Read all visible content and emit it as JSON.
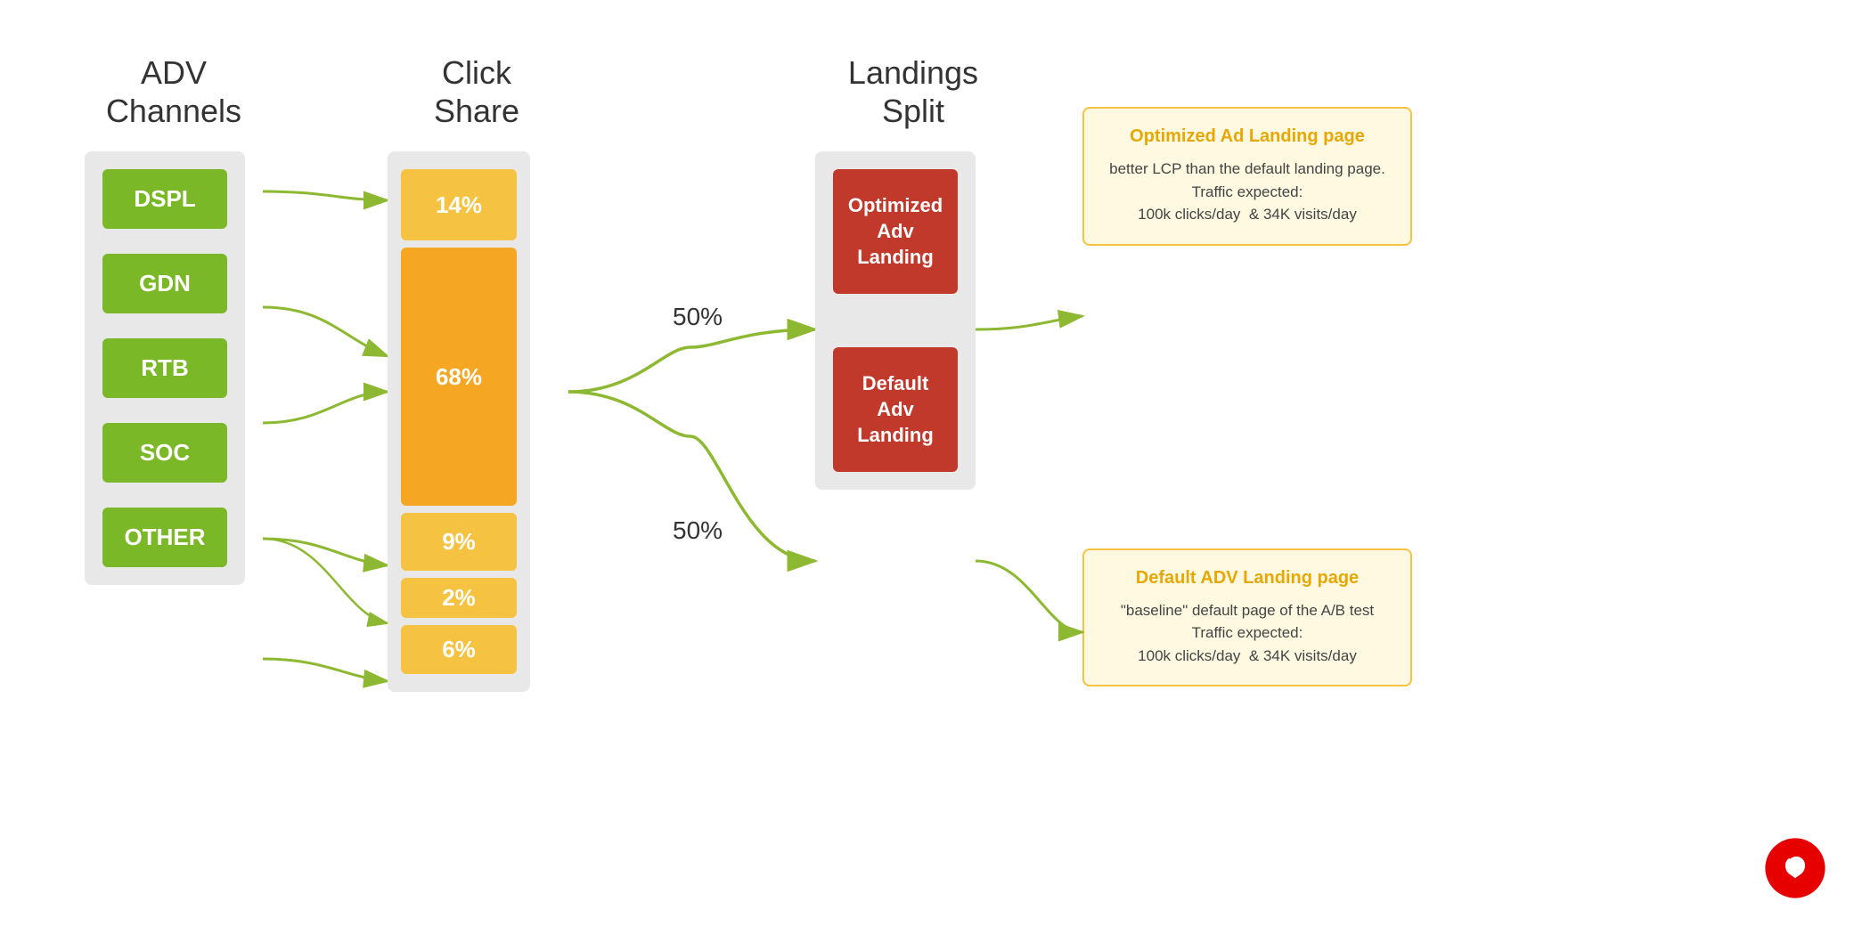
{
  "header": {
    "adv_channels_title": "ADV\nChannels",
    "click_share_title": "Click\nShare",
    "landings_split_title": "Landings\nSplit"
  },
  "adv_channels": [
    {
      "label": "DSPL"
    },
    {
      "label": "GDN"
    },
    {
      "label": "RTB"
    },
    {
      "label": "SOC"
    },
    {
      "label": "OTHER"
    }
  ],
  "click_shares": [
    {
      "label": "14%",
      "pct": 14
    },
    {
      "label": "68%",
      "pct": 68
    },
    {
      "label": "9%",
      "pct": 9
    },
    {
      "label": "2%",
      "pct": 2
    },
    {
      "label": "6%",
      "pct": 6
    }
  ],
  "split_labels": [
    {
      "label": "50%"
    },
    {
      "label": "50%"
    }
  ],
  "landings": [
    {
      "label": "Optimized\nAdv\nLanding"
    },
    {
      "label": "Default\nAdv\nLanding"
    }
  ],
  "info_cards": [
    {
      "title": "Optimized Ad Landing page",
      "text": "better LCP than the default landing page.\nTraffic expected:\n100k clicks/day  & 34K visits/day"
    },
    {
      "title": "Default ADV Landing page",
      "text": "\"baseline\" default page of the A/B test\nTraffic expected:\n100k clicks/day  & 34K visits/day"
    }
  ],
  "colors": {
    "green_box": "#7ab827",
    "orange_large": "#f5a623",
    "orange_small": "#f5c242",
    "red_box": "#c0392b",
    "bg_col": "#e8e8e8",
    "info_border": "#f5c242",
    "info_bg": "#fef9e0",
    "info_title": "#e6a800",
    "arrow_color": "#8db832",
    "vodafone_red": "#e60000"
  }
}
